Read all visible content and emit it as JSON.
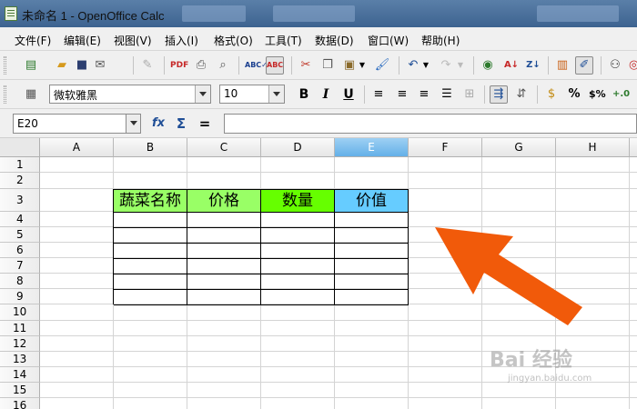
{
  "window": {
    "title": "未命名 1 - OpenOffice Calc"
  },
  "menu": [
    "文件(F)",
    "编辑(E)",
    "视图(V)",
    "插入(I)",
    "格式(O)",
    "工具(T)",
    "数据(D)",
    "窗口(W)",
    "帮助(H)"
  ],
  "formatting": {
    "font_name": "微软雅黑",
    "font_size": "10"
  },
  "formula_bar": {
    "cell_reference": "E20",
    "formula": ""
  },
  "columns": [
    "A",
    "B",
    "C",
    "D",
    "E",
    "F",
    "G",
    "H"
  ],
  "selected_column": "E",
  "rows": [
    "1",
    "2",
    "3",
    "4",
    "5",
    "6",
    "7",
    "8",
    "9",
    "10",
    "11",
    "12",
    "13",
    "14",
    "15",
    "16"
  ],
  "table": {
    "headers": [
      {
        "text": "蔬菜名称",
        "color": "#99ff66"
      },
      {
        "text": "价格",
        "color": "#99ff66"
      },
      {
        "text": "数量",
        "color": "#66ff00"
      },
      {
        "text": "价值",
        "color": "#66ccff"
      }
    ]
  },
  "annotation": {
    "arrow_color": "#f15a0a"
  },
  "watermark": {
    "logo": "Bai 经验",
    "url": "jingyan.baidu.com"
  }
}
